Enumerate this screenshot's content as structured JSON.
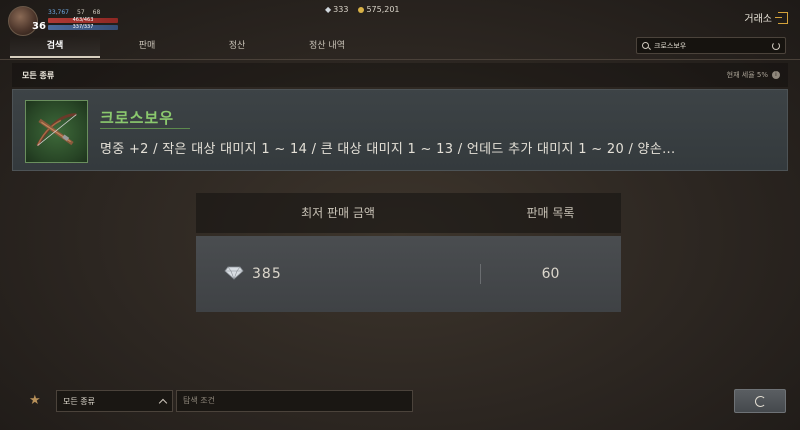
{
  "player": {
    "level": "36",
    "stat_blue": "33,767",
    "stat_2": "57",
    "stat_3": "68",
    "hp": "463/463",
    "mp": "337/337"
  },
  "currency": {
    "gems": "333",
    "gold": "575,201"
  },
  "header": {
    "title": "거래소"
  },
  "tabs": [
    {
      "label": "검색",
      "active": true
    },
    {
      "label": "판매",
      "active": false
    },
    {
      "label": "정산",
      "active": false
    },
    {
      "label": "정산 내역",
      "active": false
    }
  ],
  "search": {
    "value": "크로스보우"
  },
  "category": {
    "label": "모든 종류",
    "tax_label": "현재 세율 5%"
  },
  "item": {
    "name": "크로스보우",
    "description": "명중 +2 / 작은 대상 대미지 1 ~ 14 / 큰 대상 대미지 1 ~ 13 / 언데드 추가 대미지 1 ~ 20 / 양손..."
  },
  "price_table": {
    "col_lowest": "최저 판매 금액",
    "col_listings": "판매 목록",
    "rows": [
      {
        "price": "385",
        "listings": "60"
      }
    ]
  },
  "bottom": {
    "filter_value": "모든 종류",
    "condition_placeholder": "탐색 조건"
  },
  "colors": {
    "item_name": "#8bc96e",
    "accent": "#d4a23a"
  }
}
